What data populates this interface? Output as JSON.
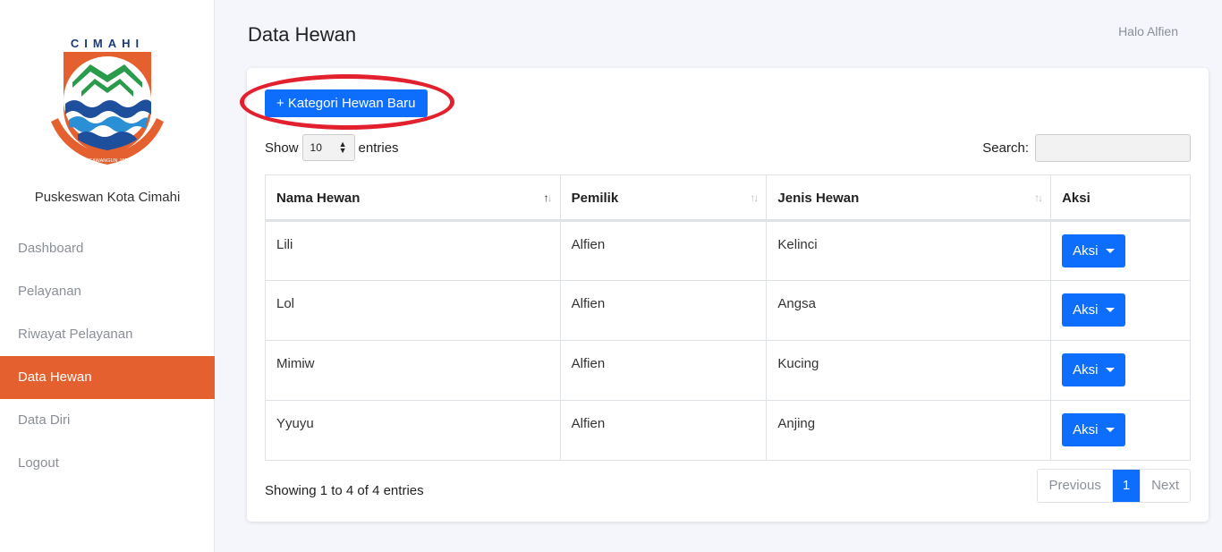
{
  "sidebar": {
    "logo_title": "CIMAHI",
    "logo_motto": "SALUYU NGAWANGUN JATI MANDIRI",
    "org_name": "Puskeswan Kota Cimahi",
    "items": [
      {
        "label": "Dashboard",
        "active": false
      },
      {
        "label": "Pelayanan",
        "active": false
      },
      {
        "label": "Riwayat Pelayanan",
        "active": false
      },
      {
        "label": "Data Hewan",
        "active": true
      },
      {
        "label": "Data Diri",
        "active": false
      },
      {
        "label": "Logout",
        "active": false
      }
    ]
  },
  "header": {
    "title": "Data Hewan",
    "greeting": "Halo Alfien"
  },
  "toolbar": {
    "new_button": "+ Kategori Hewan Baru"
  },
  "length_control": {
    "prefix": "Show",
    "value": "10",
    "suffix": "entries"
  },
  "search": {
    "label": "Search:",
    "value": ""
  },
  "table": {
    "columns": [
      "Nama Hewan",
      "Pemilik",
      "Jenis Hewan",
      "Aksi"
    ],
    "rows": [
      {
        "nama": "Lili",
        "pemilik": "Alfien",
        "jenis": "Kelinci",
        "aksi": "Aksi"
      },
      {
        "nama": "Lol",
        "pemilik": "Alfien",
        "jenis": "Angsa",
        "aksi": "Aksi"
      },
      {
        "nama": "Mimiw",
        "pemilik": "Alfien",
        "jenis": "Kucing",
        "aksi": "Aksi"
      },
      {
        "nama": "Yyuyu",
        "pemilik": "Alfien",
        "jenis": "Anjing",
        "aksi": "Aksi"
      }
    ]
  },
  "footer": {
    "info": "Showing 1 to 4 of 4 entries",
    "pagination": {
      "previous": "Previous",
      "current": "1",
      "next": "Next"
    }
  },
  "colors": {
    "accent": "#e4602f",
    "primary": "#0d6efd",
    "highlight": "#e3202d"
  }
}
